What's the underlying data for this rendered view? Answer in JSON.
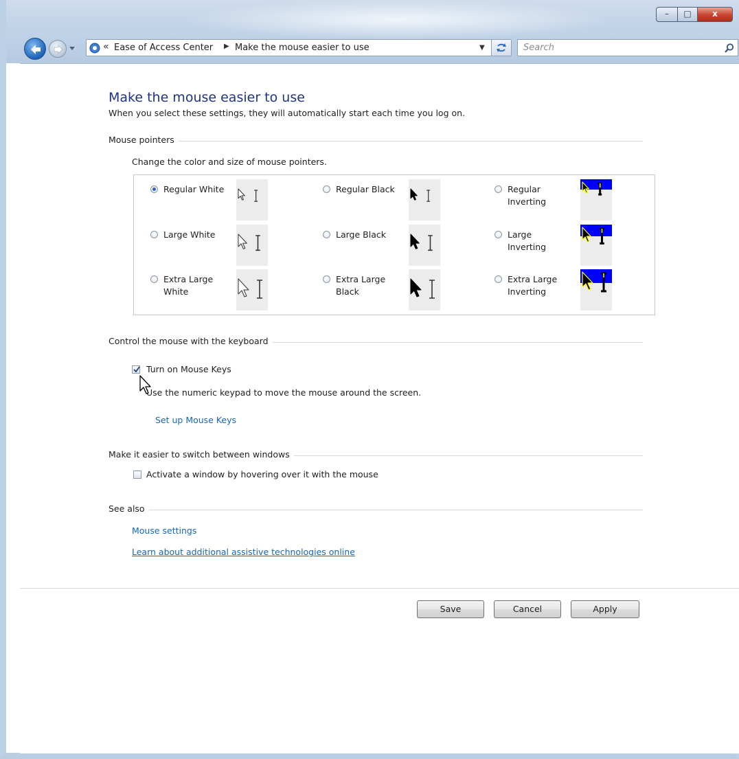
{
  "window": {
    "caption_buttons": {
      "minimize": "–",
      "maximize": "□",
      "close": "x"
    }
  },
  "address_bar": {
    "chevron": "«",
    "crumbs": [
      "Ease of Access Center",
      "Make the mouse easier to use"
    ],
    "separator": "▶",
    "dropdown": "▼"
  },
  "search": {
    "placeholder": "Search"
  },
  "page": {
    "title": "Make the mouse easier to use",
    "subtitle": "When you select these settings, they will automatically start each time you log on."
  },
  "mouse_pointers": {
    "section_label": "Mouse pointers",
    "instruction": "Change the color and size of mouse pointers.",
    "options": [
      {
        "label": "Regular White",
        "selected": true,
        "scheme": "white",
        "size": "regular"
      },
      {
        "label": "Regular Black",
        "selected": false,
        "scheme": "black",
        "size": "regular"
      },
      {
        "label": "Regular Inverting",
        "selected": false,
        "scheme": "inverting",
        "size": "regular"
      },
      {
        "label": "Large White",
        "selected": false,
        "scheme": "white",
        "size": "large"
      },
      {
        "label": "Large Black",
        "selected": false,
        "scheme": "black",
        "size": "large"
      },
      {
        "label": "Large Inverting",
        "selected": false,
        "scheme": "inverting",
        "size": "large"
      },
      {
        "label": "Extra Large White",
        "selected": false,
        "scheme": "white",
        "size": "extra-large"
      },
      {
        "label": "Extra Large Black",
        "selected": false,
        "scheme": "black",
        "size": "extra-large"
      },
      {
        "label": "Extra Large Inverting",
        "selected": false,
        "scheme": "inverting",
        "size": "extra-large"
      }
    ]
  },
  "keyboard_control": {
    "section_label": "Control the mouse with the keyboard",
    "checkbox_label": "Turn on Mouse Keys",
    "checked": true,
    "description": "Use the numeric keypad to move the mouse around the screen.",
    "link": "Set up Mouse Keys"
  },
  "window_switching": {
    "section_label": "Make it easier to switch between windows",
    "checkbox_label": "Activate a window by hovering over it with the mouse",
    "checked": false
  },
  "see_also": {
    "section_label": "See also",
    "links": [
      "Mouse settings",
      "Learn about additional assistive technologies online"
    ]
  },
  "buttons": {
    "save": "Save",
    "cancel": "Cancel",
    "apply": "Apply"
  },
  "colors": {
    "title_blue": "#1e3287",
    "link_blue": "#1566b8",
    "invert_blue": "#0000ff",
    "invert_yellow": "#ffff00"
  }
}
